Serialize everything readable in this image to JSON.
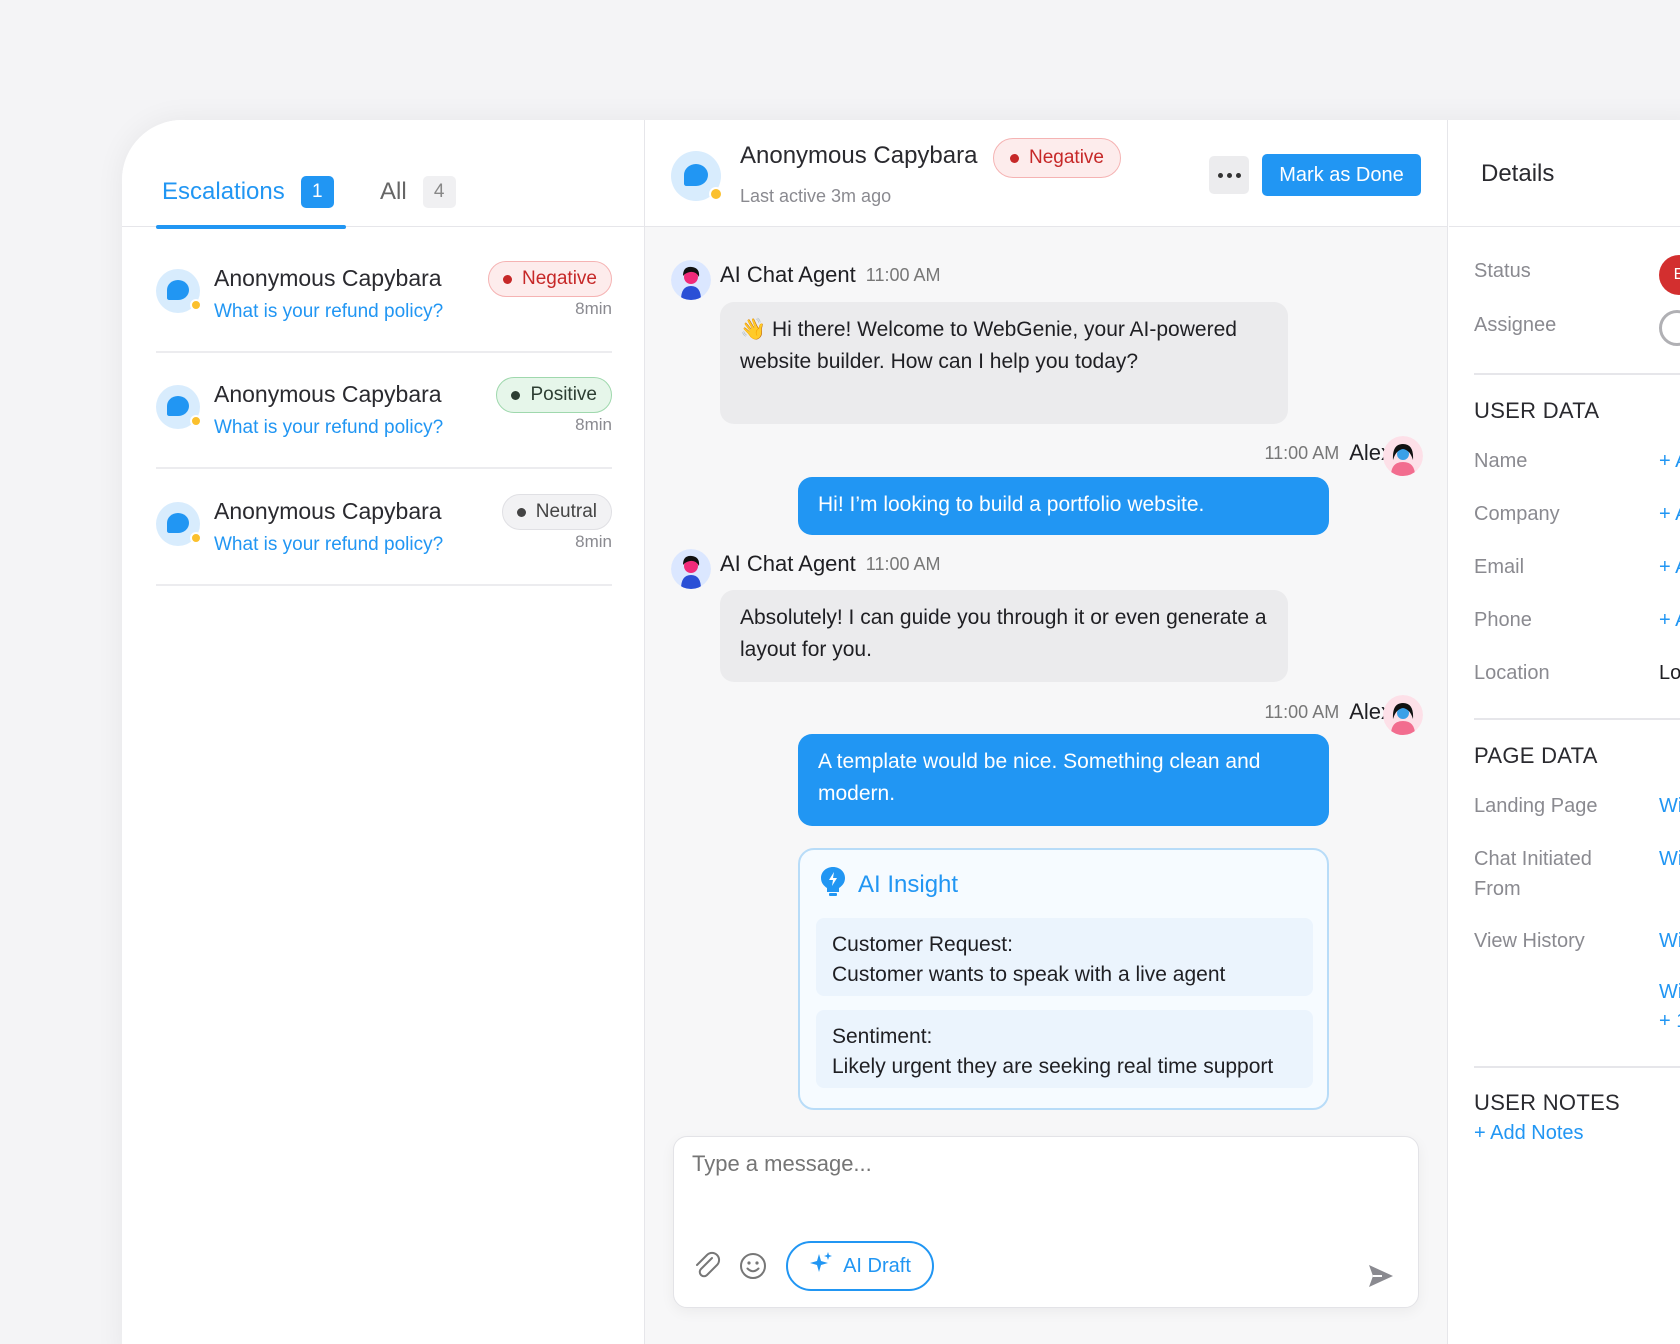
{
  "tabs": {
    "escalations": {
      "label": "Escalations",
      "count": "1"
    },
    "all": {
      "label": "All",
      "count": "4"
    }
  },
  "conversations": [
    {
      "name": "Anonymous Capybara",
      "preview": "What is your refund policy?",
      "time": "8min",
      "sentiment": "Negative"
    },
    {
      "name": "Anonymous Capybara",
      "preview": "What is your refund policy?",
      "time": "8min",
      "sentiment": "Positive"
    },
    {
      "name": "Anonymous Capybara",
      "preview": "What is your refund policy?",
      "time": "8min",
      "sentiment": "Neutral"
    }
  ],
  "chat": {
    "title": "Anonymous Capybara",
    "sentiment": "Negative",
    "last_active": "Last active 3m ago",
    "mark_done": "Mark as Done",
    "messages": [
      {
        "sender": "AI Chat Agent",
        "time": "11:00 AM",
        "text": "👋 Hi there! Welcome to WebGenie, your AI-powered website builder. How can I help you today?"
      },
      {
        "sender": "Alex",
        "time": "11:00 AM",
        "text": "Hi! I’m looking to build a portfolio website."
      },
      {
        "sender": "AI Chat Agent",
        "time": "11:00 AM",
        "text": "Absolutely! I can guide you through it or even generate a layout for you."
      },
      {
        "sender": "Alex",
        "time": "11:00 AM",
        "text": "A template would be nice. Something clean and modern."
      }
    ],
    "insight": {
      "title": "AI Insight",
      "request_label": "Customer Request:",
      "request_value": "Customer wants to speak with a live agent",
      "sentiment_label": "Sentiment:",
      "sentiment_value": "Likely urgent they are seeking real time support"
    },
    "composer": {
      "placeholder": "Type a message...",
      "ai_draft": "AI Draft"
    }
  },
  "details": {
    "title": "Details",
    "status_label": "Status",
    "status_initial": "E",
    "assignee_label": "Assignee",
    "user_data_title": "USER DATA",
    "name_label": "Name",
    "name_value": "+ A",
    "company_label": "Company",
    "company_value": "+ A",
    "email_label": "Email",
    "email_value": "+ A",
    "phone_label": "Phone",
    "phone_value": "+ A",
    "location_label": "Location",
    "location_value": "Lo",
    "page_data_title": "PAGE DATA",
    "landing_label": "Landing Page",
    "landing_value": "Wi",
    "initiated_label": "Chat Initiated From",
    "initiated_value": "Wi",
    "history_label": "View History",
    "history_value_1": "Wi",
    "history_value_2": "Wi",
    "history_more": "+ 1",
    "notes_title": "USER NOTES",
    "add_notes": "+ Add Notes"
  },
  "colors": {
    "accent": "#2196f3",
    "negative": "#c62828",
    "positive": "#9fd8ad",
    "presence": "#fbc02d"
  }
}
